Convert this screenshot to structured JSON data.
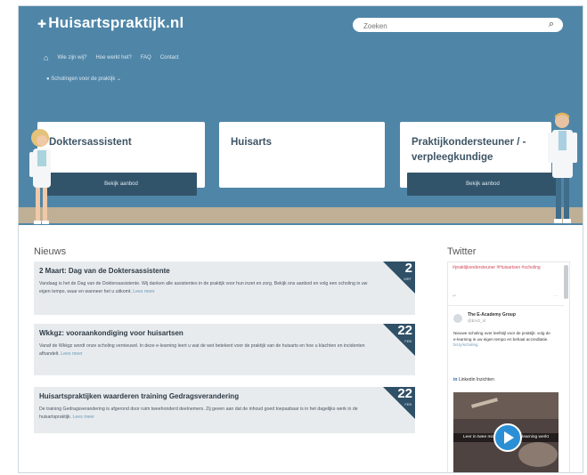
{
  "site": {
    "logo": "Huisartspraktijk.nl",
    "logo_icon": "stethoscope-icon"
  },
  "search": {
    "placeholder": "Zoeken"
  },
  "nav": {
    "items": [
      "Wie zijn wij?",
      "Hoe werkt het?",
      "FAQ",
      "Contact"
    ],
    "sub": "Scholingen voor de praktijk"
  },
  "cards": [
    {
      "title": "Doktersassistent",
      "button": "Bekijk aanbod"
    },
    {
      "title": "Huisarts",
      "button": ""
    },
    {
      "title": "Praktijkondersteuner / -verpleegkundige",
      "button": "Bekijk aanbod"
    }
  ],
  "news": {
    "heading": "Nieuws",
    "items": [
      {
        "title": "2 Maart: Dag van de Doktersassistente",
        "body": "Vandaag is het de Dag van de Doktersassistente. Wij danken alle assistentes in de praktijk voor hun inzet en zorg. Bekijk ons aanbod en volg een scholing in uw eigen tempo, waar en wanneer het u uitkomt.",
        "more": "Lees meer",
        "day": "2",
        "month": "MRT"
      },
      {
        "title": "Wkkgz: vooraankondiging voor huisartsen",
        "body": "Vanaf de Wkkgz wordt onze scholing vernieuwd. In deze e-learning leert u wat de wet betekent voor de praktijk van de huisarts en hoe u klachten en incidenten afhandelt.",
        "more": "Lees meer",
        "day": "22",
        "month": "FEB"
      },
      {
        "title": "Huisartspraktijken waarderen training Gedragsverandering",
        "body": "De training Gedragsverandering is afgerond door ruim tweehonderd deelnemers. Zij geven aan dat de inhoud goed toepasbaar is in het dagelijks werk in de huisartspraktijk.",
        "more": "Lees meer",
        "day": "22",
        "month": "FEB"
      }
    ]
  },
  "twitter": {
    "heading": "Twitter",
    "tweet1": "#praktijkondersteuner #Huisartsen #scholing",
    "user": "The E-Academy Group",
    "handle": "@EAG_nl",
    "tweet2": "Nieuwe scholing over leefstijl voor de praktijk: volg de e-learning in uw eigen tempo en behaal accreditatie.",
    "tweet2_link": "bit.ly/scholing",
    "link_label": "Linkedin Inzichten",
    "video_caption": "Leer in twee minuten hoe de e-learning werkt"
  },
  "colors": {
    "header": "#4f86a8",
    "button": "#32546a",
    "floor": "#bfaf95",
    "news_bg": "#e8ebee",
    "play": "#2b8fd6"
  }
}
